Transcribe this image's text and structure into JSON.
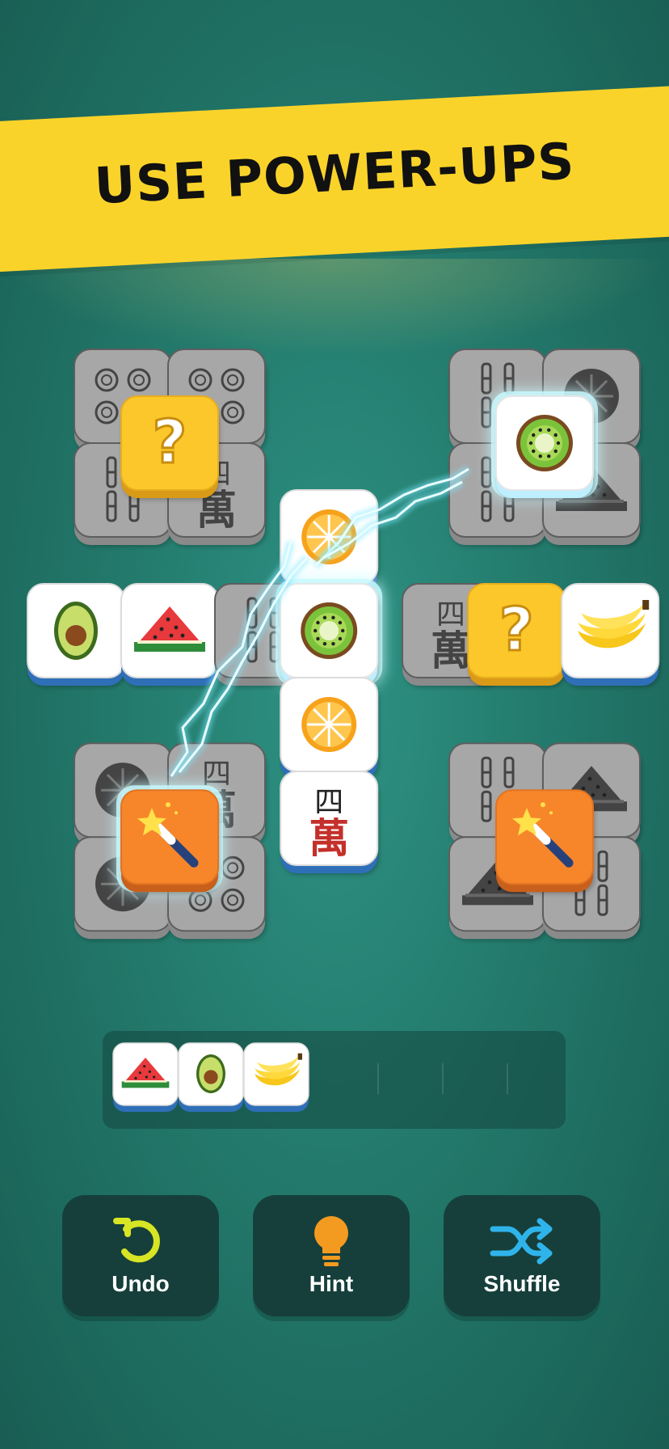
{
  "banner": {
    "title": "USE POWER-UPS"
  },
  "tiles": [
    {
      "col": 0,
      "row": 0,
      "kind": "gray",
      "face": "circles"
    },
    {
      "col": 1,
      "row": 0,
      "kind": "gray",
      "face": "circles"
    },
    {
      "col": 0,
      "row": 1,
      "kind": "gray",
      "face": "bamboo"
    },
    {
      "col": 1,
      "row": 1,
      "kind": "gray",
      "face": "wan"
    },
    {
      "col": 0.5,
      "row": 0.5,
      "kind": "question",
      "face": "question"
    },
    {
      "col": 4,
      "row": 0,
      "kind": "gray",
      "face": "bamboo"
    },
    {
      "col": 5,
      "row": 0,
      "kind": "gray",
      "face": "orange"
    },
    {
      "col": 4,
      "row": 1,
      "kind": "gray",
      "face": "bamboo"
    },
    {
      "col": 5,
      "row": 1,
      "kind": "gray",
      "face": "watermelon"
    },
    {
      "col": 4.5,
      "row": 0.5,
      "kind": "white-glow",
      "face": "kiwi"
    },
    {
      "col": -0.5,
      "row": 2.5,
      "kind": "white",
      "face": "avocado"
    },
    {
      "col": 0.5,
      "row": 2.5,
      "kind": "white",
      "face": "watermelon"
    },
    {
      "col": 1.5,
      "row": 2.5,
      "kind": "gray",
      "face": "bamboo"
    },
    {
      "col": 3.5,
      "row": 2.5,
      "kind": "gray",
      "face": "wan"
    },
    {
      "col": 4.2,
      "row": 2.5,
      "kind": "question",
      "face": "question"
    },
    {
      "col": 5.2,
      "row": 2.5,
      "kind": "white",
      "face": "banana"
    },
    {
      "col": 2.2,
      "row": 1.5,
      "kind": "white",
      "face": "orange"
    },
    {
      "col": 2.2,
      "row": 2.5,
      "kind": "white-glow",
      "face": "kiwi"
    },
    {
      "col": 2.2,
      "row": 3.5,
      "kind": "white",
      "face": "orange"
    },
    {
      "col": 2.2,
      "row": 4.5,
      "kind": "white",
      "face": "wan"
    },
    {
      "col": 0,
      "row": 4.2,
      "kind": "gray",
      "face": "orange"
    },
    {
      "col": 1,
      "row": 4.2,
      "kind": "gray",
      "face": "wan"
    },
    {
      "col": 0,
      "row": 5.2,
      "kind": "gray",
      "face": "orange"
    },
    {
      "col": 1,
      "row": 5.2,
      "kind": "gray",
      "face": "circles"
    },
    {
      "col": 0.5,
      "row": 4.7,
      "kind": "magic-glow",
      "face": "wand"
    },
    {
      "col": 4,
      "row": 4.2,
      "kind": "gray",
      "face": "bamboo"
    },
    {
      "col": 5,
      "row": 4.2,
      "kind": "gray",
      "face": "watermelon"
    },
    {
      "col": 4,
      "row": 5.2,
      "kind": "gray",
      "face": "watermelon"
    },
    {
      "col": 5,
      "row": 5.2,
      "kind": "gray",
      "face": "bamboo"
    },
    {
      "col": 4.5,
      "row": 4.7,
      "kind": "magic",
      "face": "wand"
    }
  ],
  "wan_text": {
    "top": "四",
    "bottom": "萬"
  },
  "question_mark": "?",
  "tray": {
    "items": [
      "watermelon",
      "avocado",
      "banana"
    ],
    "slots": 7
  },
  "buttons": [
    {
      "id": "undo",
      "label": "Undo",
      "icon": "undo-icon",
      "color": "#d7e524"
    },
    {
      "id": "hint",
      "label": "Hint",
      "icon": "lightbulb-icon",
      "color": "#f39b20"
    },
    {
      "id": "shuffle",
      "label": "Shuffle",
      "icon": "shuffle-icon",
      "color": "#2fb4ea"
    }
  ],
  "colors": {
    "banner": "#fad32a",
    "lightning": "#bff6ff",
    "magic": "#f7862a",
    "question": "#fbc72a"
  }
}
